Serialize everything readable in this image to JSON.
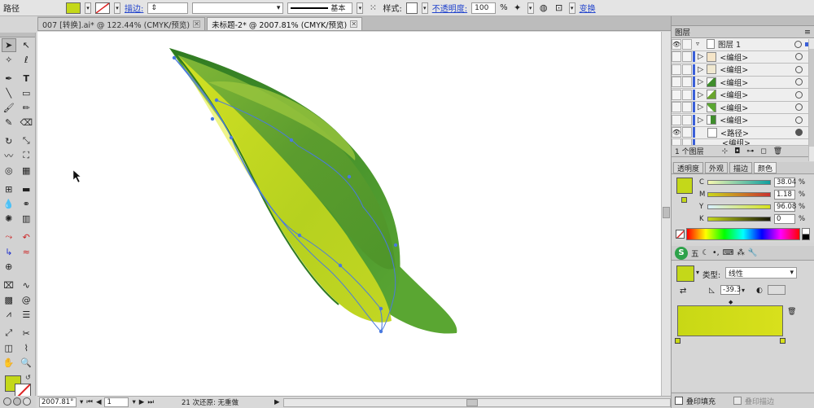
{
  "control_bar": {
    "object_type": "路径",
    "fill_color": "#c4d819",
    "stroke_label": "描边:",
    "stroke_profile": "基本",
    "style_label": "样式:",
    "opacity_label": "不透明度:",
    "opacity_value": "100",
    "opacity_unit": "%",
    "transform_label": "变换"
  },
  "tabs": [
    {
      "label": "007 [转换].ai* @ 122.44% (CMYK/预览)"
    },
    {
      "label": "未标题-2* @ 2007.81% (CMYK/预览)"
    }
  ],
  "status": {
    "zoom": "2007.81°",
    "page": "1",
    "undo": "21 次还原: 无重做"
  },
  "layers_panel": {
    "title": "图层",
    "layer_name": "图层 1",
    "items": [
      {
        "name": "<编组>"
      },
      {
        "name": "<编组>"
      },
      {
        "name": "<编组>"
      },
      {
        "name": "<编组>"
      },
      {
        "name": "<编组>"
      },
      {
        "name": "<编组>"
      },
      {
        "name": "<路径>"
      },
      {
        "name": "<编组>"
      }
    ],
    "footer": "1 个图层"
  },
  "color_panel": {
    "tabs": [
      "透明度",
      "外观",
      "描边",
      "颜色"
    ],
    "channels": [
      {
        "label": "C",
        "value": "38.04"
      },
      {
        "label": "M",
        "value": "1.18"
      },
      {
        "label": "Y",
        "value": "96.08"
      },
      {
        "label": "K",
        "value": "0"
      }
    ],
    "swatch": "#c4d819"
  },
  "gradient_panel": {
    "type_label": "类型:",
    "type_value": "线性",
    "angle_value": "-39.3",
    "bar_start": "#c8d815",
    "bar_end": "#d8e01c"
  },
  "attributes": {
    "overprint_fill": "叠印填充",
    "overprint_stroke": "叠印描边"
  },
  "colors": {
    "leaf_dark": "#3f8d2c",
    "leaf_mid": "#6aa52e",
    "leaf_yellow": "#c9db22",
    "path_blue": "#4a7adf"
  }
}
